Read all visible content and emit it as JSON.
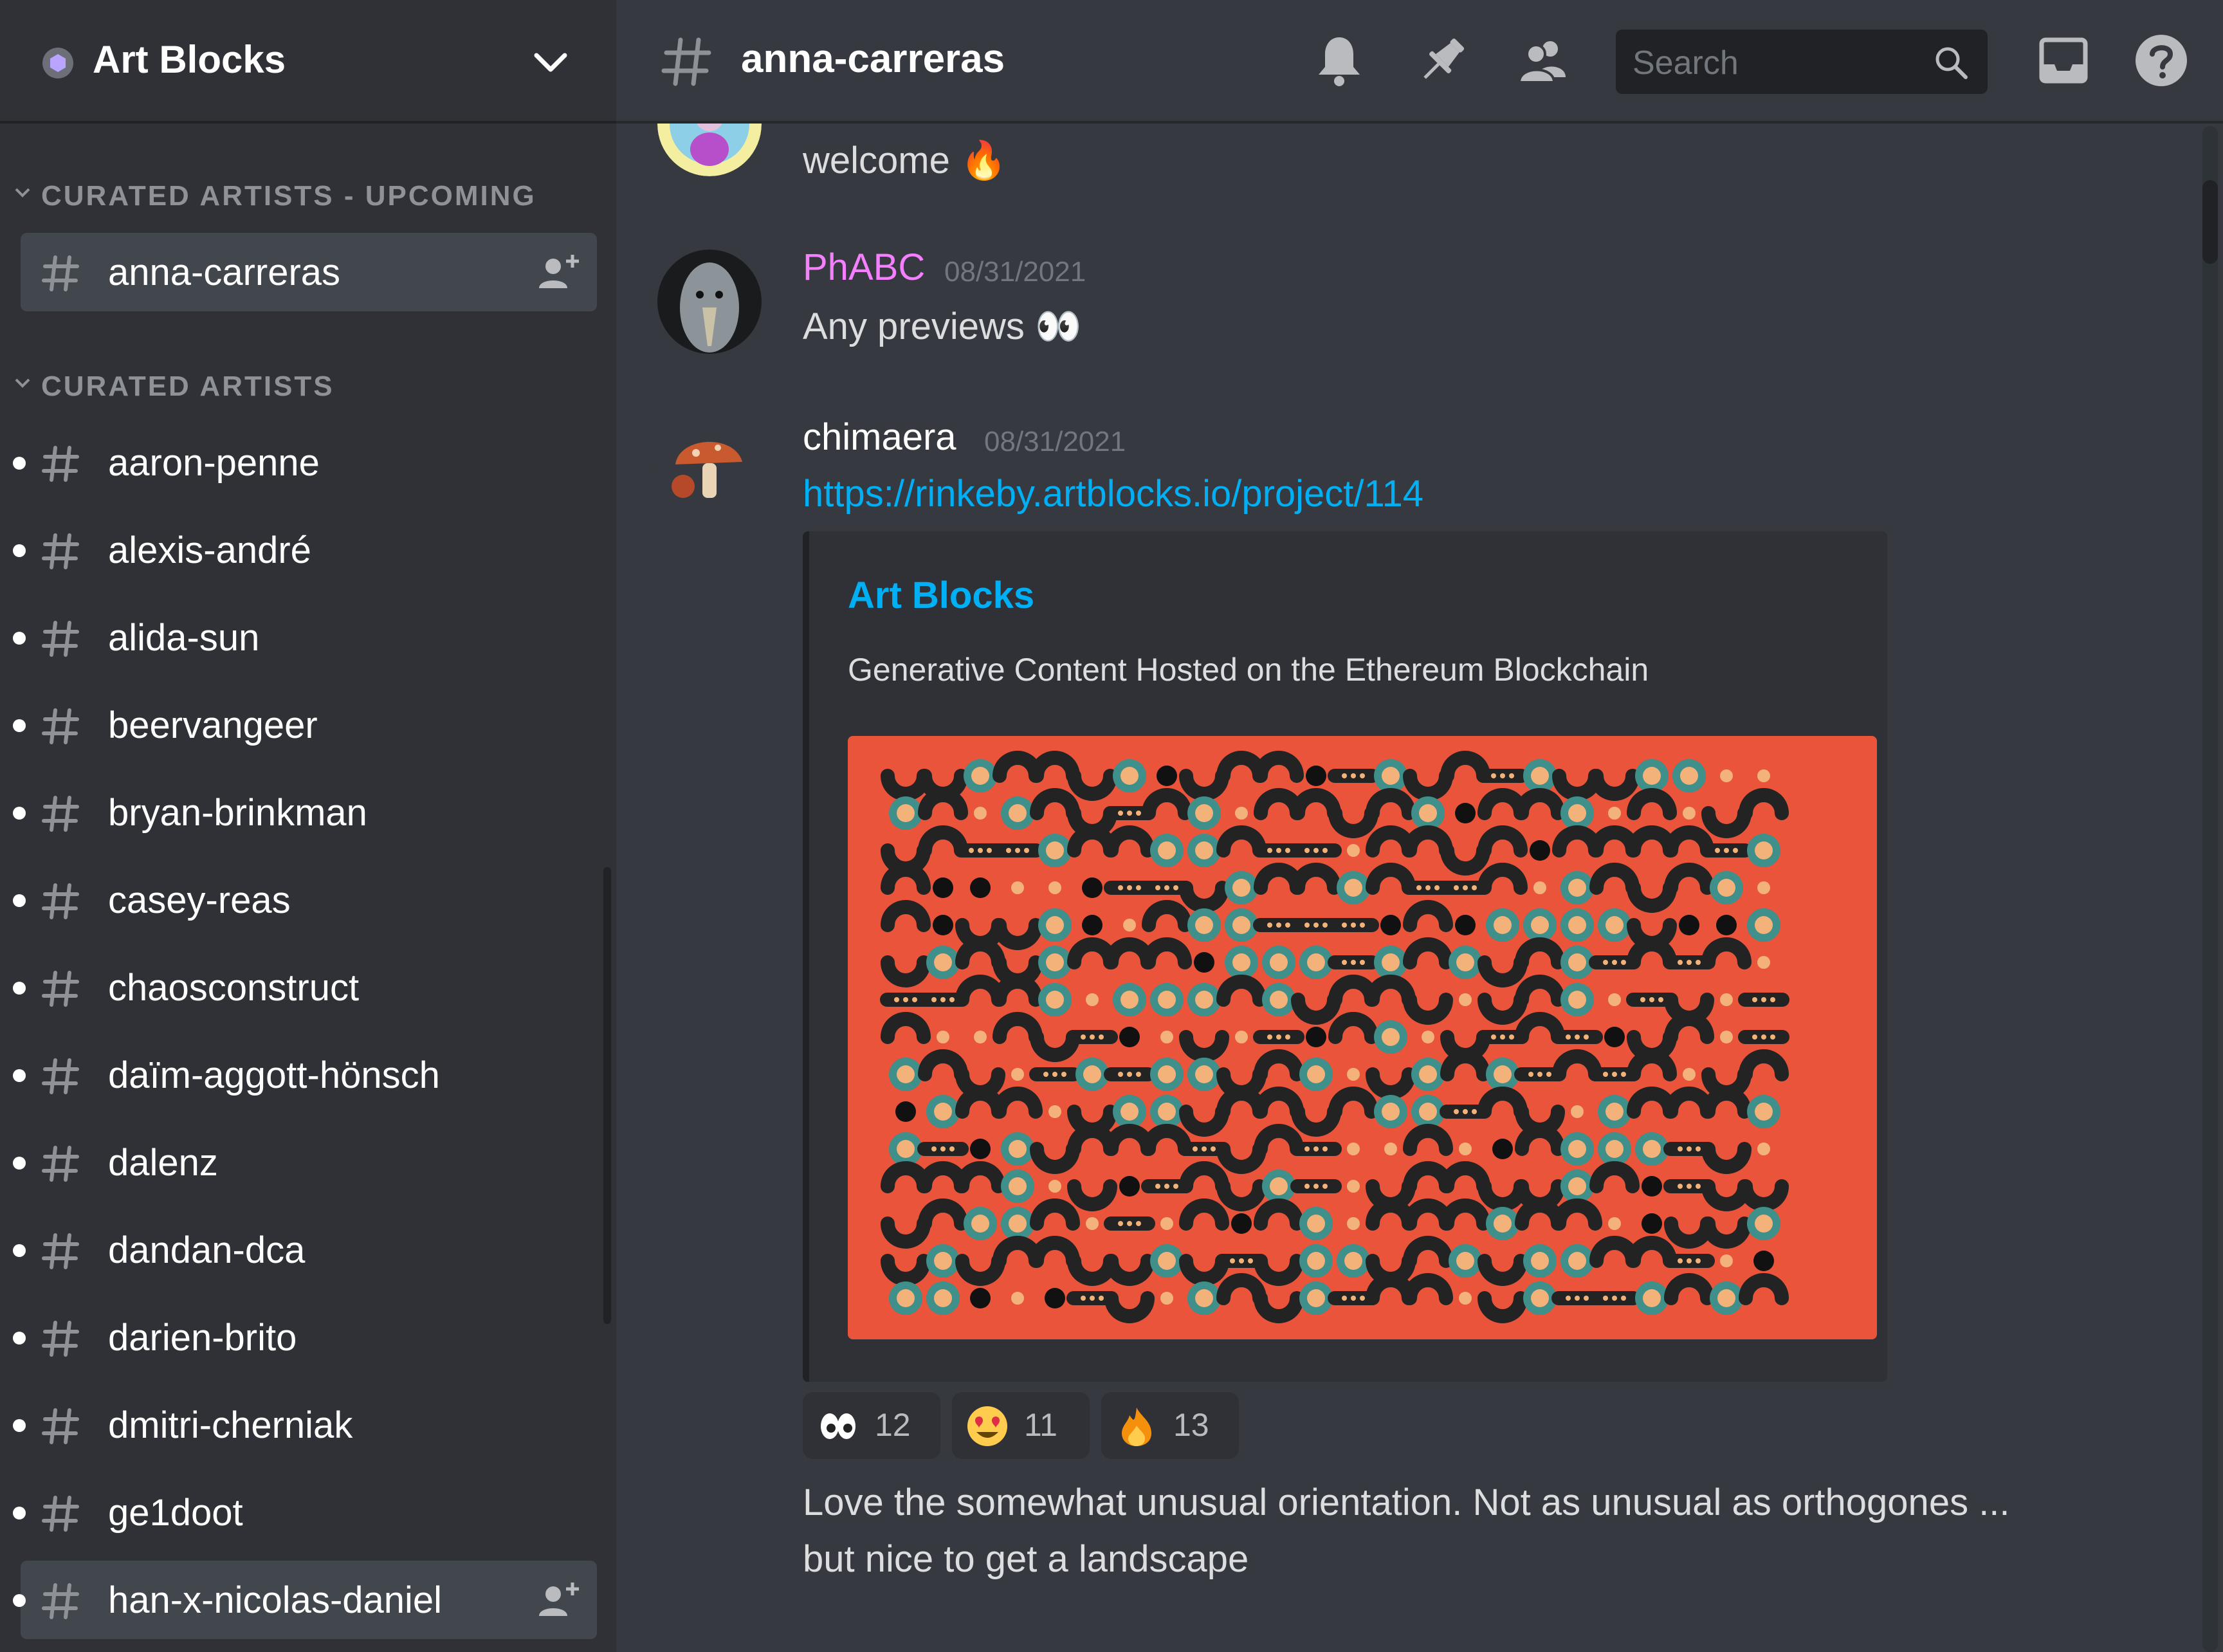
{
  "server": {
    "name": "Art Blocks"
  },
  "sidebar": {
    "categories": [
      {
        "label": "CURATED ARTISTS - UPCOMING",
        "channels": [
          {
            "name": "anna-carreras"
          }
        ]
      },
      {
        "label": "CURATED ARTISTS",
        "channels": [
          {
            "name": "aaron-penne"
          },
          {
            "name": "alexis-andré"
          },
          {
            "name": "alida-sun"
          },
          {
            "name": "beervangeer"
          },
          {
            "name": "bryan-brinkman"
          },
          {
            "name": "casey-reas"
          },
          {
            "name": "chaosconstruct"
          },
          {
            "name": "daïm-aggott-hönsch"
          },
          {
            "name": "dalenz"
          },
          {
            "name": "dandan-dca"
          },
          {
            "name": "darien-brito"
          },
          {
            "name": "dmitri-cherniak"
          },
          {
            "name": "ge1doot"
          },
          {
            "name": "han-x-nicolas-daniel"
          }
        ]
      }
    ]
  },
  "header": {
    "channel": "anna-carreras",
    "search_placeholder": "Search"
  },
  "messages": [
    {
      "text": "welcome 🔥"
    },
    {
      "user": "PhABC",
      "user_color": "#f47fff",
      "time": "08/31/2021",
      "text": "Any previews 👀"
    },
    {
      "user": "chimaera",
      "user_color": "#ffffff",
      "time": "08/31/2021",
      "link": "https://rinkeby.artblocks.io/project/114",
      "embed": {
        "provider": "Art Blocks",
        "description": "Generative Content Hosted on the Ethereum Blockchain"
      },
      "reactions": [
        {
          "emoji": "eyes",
          "count": "12"
        },
        {
          "emoji": "heart-eyes",
          "count": "11"
        },
        {
          "emoji": "fire",
          "count": "13"
        }
      ],
      "followup_line1": "Love the somewhat unusual orientation.  Not as unusual as orthogones ...",
      "followup_line2": "but nice to get a landscape"
    }
  ],
  "colors": {
    "accent_link": "#00aff4",
    "artwork_bg": "#e9543b",
    "artwork_teal": "#3f8f8b",
    "artwork_dark": "#232323",
    "artwork_peach": "#f2b27a"
  }
}
